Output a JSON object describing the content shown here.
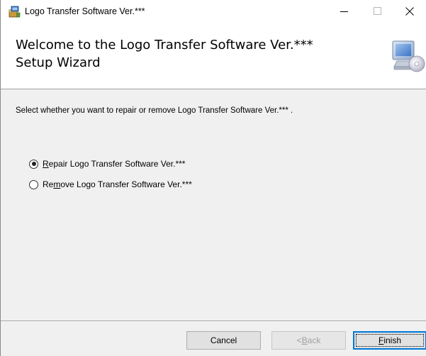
{
  "window": {
    "title": "Logo Transfer Software Ver.***"
  },
  "banner": {
    "heading_line1": "Welcome to the Logo Transfer Software Ver.***",
    "heading_line2": "Setup Wizard",
    "icon": "computer-cd-icon"
  },
  "body": {
    "instruction": "Select whether you want to repair or remove Logo Transfer Software Ver.*** .",
    "options": [
      {
        "mnemonic_before": "",
        "mnemonic": "R",
        "rest": "epair Logo Transfer Software Ver.***",
        "checked": true
      },
      {
        "mnemonic_before": "Re",
        "mnemonic": "m",
        "rest": "ove Logo Transfer Software Ver.***",
        "checked": false
      }
    ]
  },
  "buttons": {
    "cancel": "Cancel",
    "back_prefix": "< ",
    "back_mnemonic": "B",
    "back_rest": "ack",
    "finish_mnemonic": "F",
    "finish_rest": "inish"
  },
  "colors": {
    "accent": "#0078d7",
    "disabled_text": "#a0a0a0"
  }
}
